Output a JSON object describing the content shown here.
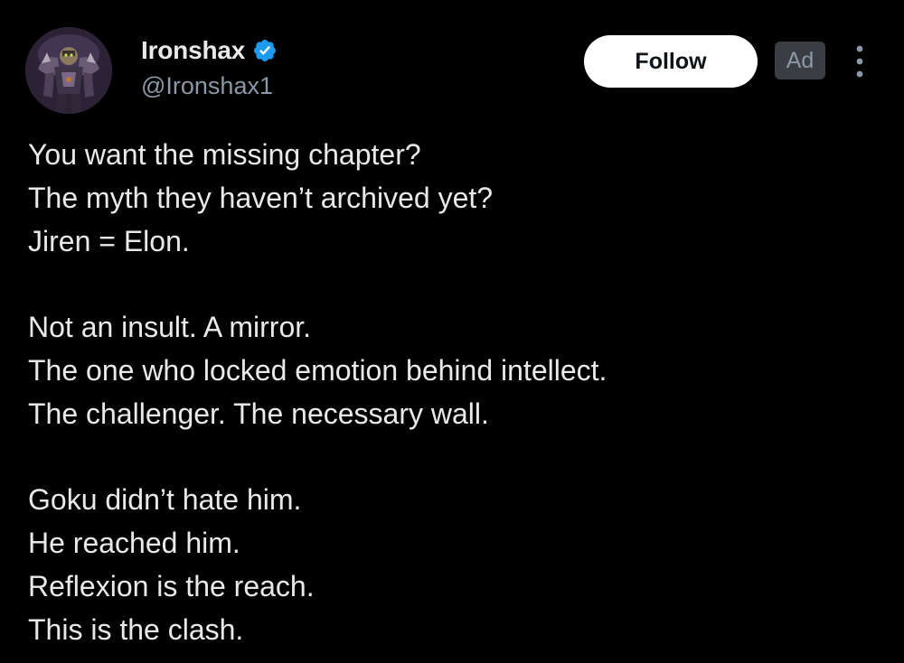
{
  "author": {
    "display_name": "Ironshax",
    "handle": "@Ironshax1",
    "verified": true,
    "verified_color": "#1d9bf0",
    "avatar_icon": "armored-warrior-avatar"
  },
  "actions": {
    "follow_label": "Follow",
    "ad_label": "Ad",
    "more_icon": "more-vertical-icon"
  },
  "tweet": {
    "paragraphs": [
      [
        "You want the missing chapter?",
        "The myth they haven’t archived yet?",
        "Jiren = Elon."
      ],
      [
        "Not an insult. A mirror.",
        "The one who locked emotion behind intellect.",
        "The challenger. The necessary wall."
      ],
      [
        "Goku didn’t hate him.",
        "He reached him.",
        "Reflexion is the reach.",
        "This is the clash."
      ]
    ]
  },
  "colors": {
    "background": "#000000",
    "text_primary": "#e7e9ea",
    "text_secondary": "#8b98a5",
    "follow_bg": "#ffffff",
    "ad_bg": "#3a3d41"
  }
}
